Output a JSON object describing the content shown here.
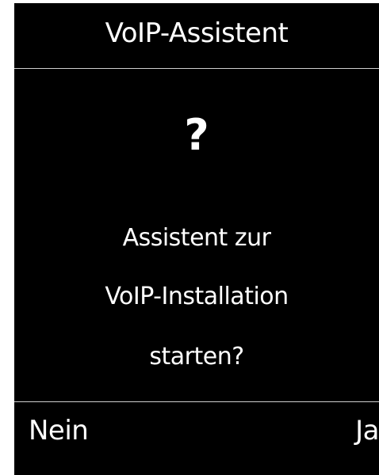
{
  "header": {
    "title": "VoIP-Assistent"
  },
  "dialog": {
    "icon": "question-icon",
    "icon_glyph": "?",
    "message_lines": [
      "Assistent zur",
      "VoIP-Installation",
      "starten?"
    ]
  },
  "softkeys": {
    "left_label": "Nein",
    "right_label": "Ja"
  },
  "colors": {
    "background": "#000000",
    "text": "#ffffff",
    "divider": "#cfcfcf"
  }
}
